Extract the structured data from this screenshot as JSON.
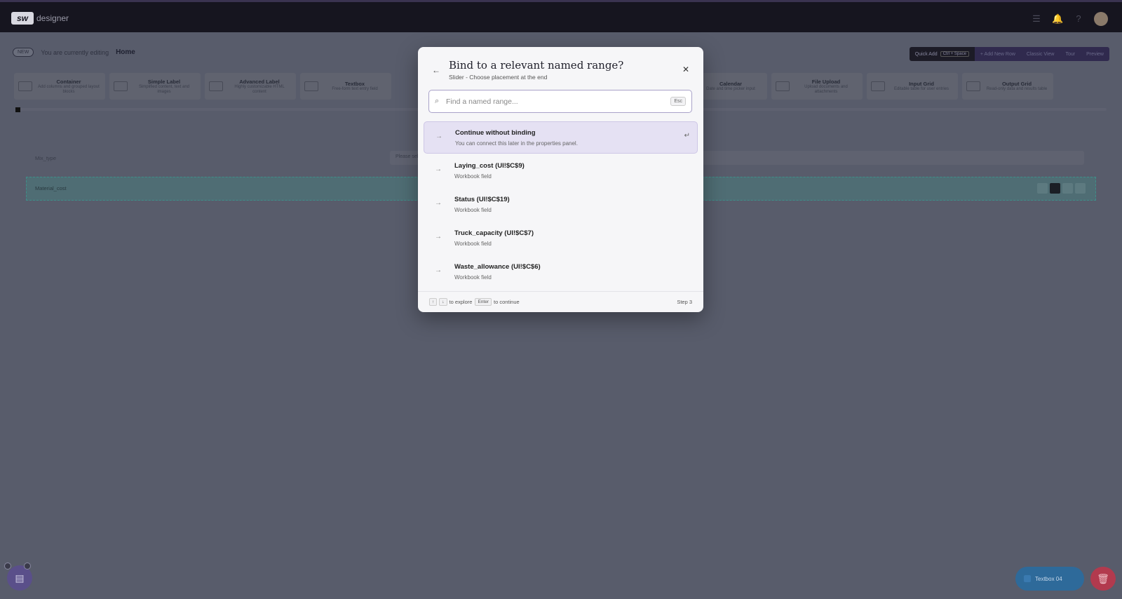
{
  "topbar": {
    "logo_mark": "sw",
    "logo_text": "designer"
  },
  "editbar": {
    "badge": "NEW",
    "text": "You are currently editing",
    "page": "Home"
  },
  "actions": {
    "quick_add": "Quick Add",
    "shortcut": "Ctrl + Space",
    "add_row": "+ Add New Row",
    "classic": "Classic View",
    "tour": "Tour",
    "preview": "Preview"
  },
  "palette": [
    {
      "title": "Container",
      "desc": "Add columns and grouped layout blocks",
      "icon": "container-icon"
    },
    {
      "title": "Simple Label",
      "desc": "Simplified content, text and images",
      "icon": "text-icon"
    },
    {
      "title": "Advanced Label",
      "desc": "Highly customizable HTML content",
      "icon": "html-icon"
    },
    {
      "title": "Textbox",
      "desc": "Free-form text entry field",
      "icon": "textbox-icon"
    },
    {
      "title": "Calendar",
      "desc": "Date and time picker input",
      "icon": "calendar-icon"
    },
    {
      "title": "File Upload",
      "desc": "Upload documents and attachments",
      "icon": "file-icon"
    },
    {
      "title": "Input Grid",
      "desc": "Editable table for user entries",
      "icon": "grid-icon"
    },
    {
      "title": "Output Grid",
      "desc": "Read-only data and results table",
      "icon": "table-icon"
    }
  ],
  "canvas": {
    "row1_label": "Mix_type",
    "row1_placeholder": "Please select",
    "row2_label": "Material_cost"
  },
  "dialog": {
    "title": "Bind to a relevant named range?",
    "subtitle": "Slider - Choose placement at the end",
    "search_placeholder": "Find a named range...",
    "esc": "Esc",
    "options": [
      {
        "title": "Continue without binding",
        "sub": "You can connect this later in the properties panel."
      },
      {
        "title": "Laying_cost (UI!$C$9)",
        "sub": "Workbook field"
      },
      {
        "title": "Status (UI!$C$19)",
        "sub": "Workbook field"
      },
      {
        "title": "Truck_capacity (UI!$C$7)",
        "sub": "Workbook field"
      },
      {
        "title": "Waste_allowance (UI!$C$6)",
        "sub": "Workbook field"
      }
    ],
    "footer": {
      "explore": "to explore",
      "enter_key": "Enter",
      "continue": "to continue",
      "step": "Step 3"
    }
  },
  "bottom": {
    "textbox_pill": "Textbox 04"
  }
}
